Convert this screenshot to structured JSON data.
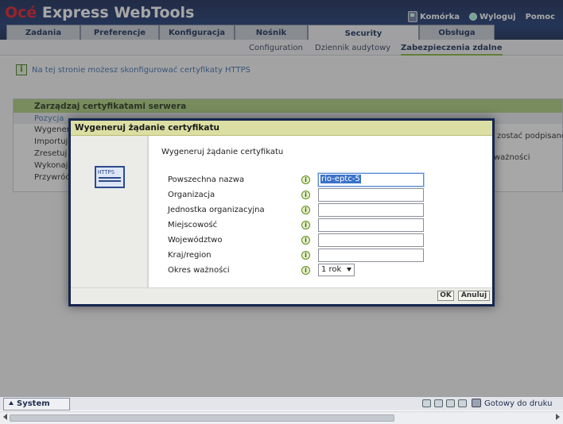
{
  "app": {
    "logo_brand": "Océ",
    "logo_rest": " Express WebTools"
  },
  "topnav": {
    "mobile": "Komórka",
    "logout": "Wyloguj",
    "help": "Pomoc"
  },
  "tabs": [
    "Zadania",
    "Preferencje",
    "Konfiguracja",
    "Nośnik",
    "Security",
    "Obsługa"
  ],
  "active_tab": "Security",
  "subtabs": [
    "Configuration",
    "Dziennik audytowy",
    "Zabezpieczenia zdalne"
  ],
  "active_subtab": "Zabezpieczenia zdalne",
  "info_text": "Na tej stronie możesz skonfigurować certyfikaty HTTPS",
  "panel": {
    "title": "Zarządzaj certyfikatami serwera",
    "column_header": "Pozycja",
    "items": [
      "Wygeneru",
      "Importuj",
      "Zresetuj c",
      "Wykonaj",
      "Przywróć"
    ],
    "right_fragments": [
      "zostać podpisane p",
      "ważności"
    ]
  },
  "dialog": {
    "title": "Wygeneruj żądanie certyfikatu",
    "subtitle": "Wygeneruj żądanie certyfikatu",
    "icon_label": "HTTPS",
    "help_glyph": "i",
    "fields": [
      {
        "label": "Powszechna nazwa",
        "value": "rio-eptc-5"
      },
      {
        "label": "Organizacja",
        "value": ""
      },
      {
        "label": "Jednostka organizacyjna",
        "value": ""
      },
      {
        "label": "Miejscowość",
        "value": ""
      },
      {
        "label": "Województwo",
        "value": ""
      },
      {
        "label": "Kraj/region",
        "value": ""
      }
    ],
    "validity": {
      "label": "Okres ważności",
      "value": "1 rok"
    },
    "ok_label": "OK",
    "cancel_label": "Anuluj"
  },
  "statusbar": {
    "system_label": "System",
    "status_text": "Gotowy do druku"
  },
  "colors": {
    "header_bg": "#13306e",
    "brand_red": "#e4121b",
    "panel_head": "#a9ce79",
    "dialog_head": "#dcdfa3"
  }
}
